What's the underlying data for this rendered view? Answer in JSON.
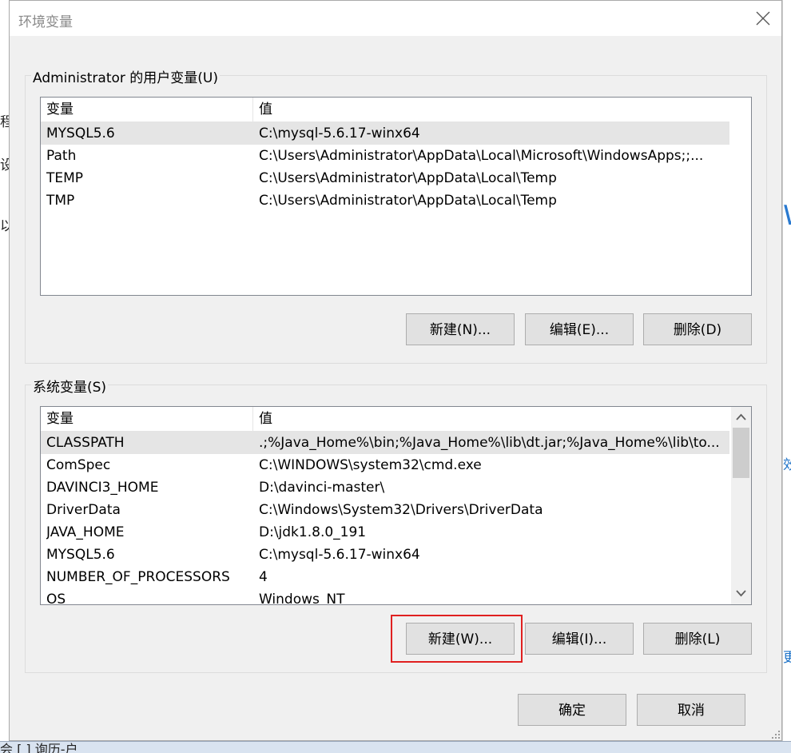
{
  "window": {
    "title": "环境变量"
  },
  "user_vars": {
    "group_label": "Administrator 的用户变量(U)",
    "headers": {
      "name": "变量",
      "value": "值"
    },
    "rows": [
      {
        "name": "MYSQL5.6",
        "value": "C:\\mysql-5.6.17-winx64",
        "selected": true
      },
      {
        "name": "Path",
        "value": "C:\\Users\\Administrator\\AppData\\Local\\Microsoft\\WindowsApps;;..."
      },
      {
        "name": "TEMP",
        "value": "C:\\Users\\Administrator\\AppData\\Local\\Temp"
      },
      {
        "name": "TMP",
        "value": "C:\\Users\\Administrator\\AppData\\Local\\Temp"
      }
    ],
    "buttons": {
      "new": "新建(N)...",
      "edit": "编辑(E)...",
      "delete": "删除(D)"
    }
  },
  "system_vars": {
    "group_label": "系统变量(S)",
    "headers": {
      "name": "变量",
      "value": "值"
    },
    "rows": [
      {
        "name": "CLASSPATH",
        "value": ".;%Java_Home%\\bin;%Java_Home%\\lib\\dt.jar;%Java_Home%\\lib\\to...",
        "selected": true
      },
      {
        "name": "ComSpec",
        "value": "C:\\WINDOWS\\system32\\cmd.exe"
      },
      {
        "name": "DAVINCI3_HOME",
        "value": "D:\\davinci-master\\"
      },
      {
        "name": "DriverData",
        "value": "C:\\Windows\\System32\\Drivers\\DriverData"
      },
      {
        "name": "JAVA_HOME",
        "value": "D:\\jdk1.8.0_191"
      },
      {
        "name": "MYSQL5.6",
        "value": "C:\\mysql-5.6.17-winx64"
      },
      {
        "name": "NUMBER_OF_PROCESSORS",
        "value": "4"
      },
      {
        "name": "OS",
        "value": "Windows_NT"
      }
    ],
    "buttons": {
      "new": "新建(W)...",
      "edit": "编辑(I)...",
      "delete": "删除(L)"
    }
  },
  "footer": {
    "ok": "确定",
    "cancel": "取消"
  },
  "background": {
    "left_fragments": [
      "程",
      "设",
      "以"
    ],
    "right_fragments": [
      "W",
      "效",
      "更"
    ],
    "taskbar_text": "会 [ ] 询历-户"
  },
  "colors": {
    "highlight": "#e02020",
    "selected_row": "#e5e5e5",
    "button_face": "#e1e1e1"
  }
}
